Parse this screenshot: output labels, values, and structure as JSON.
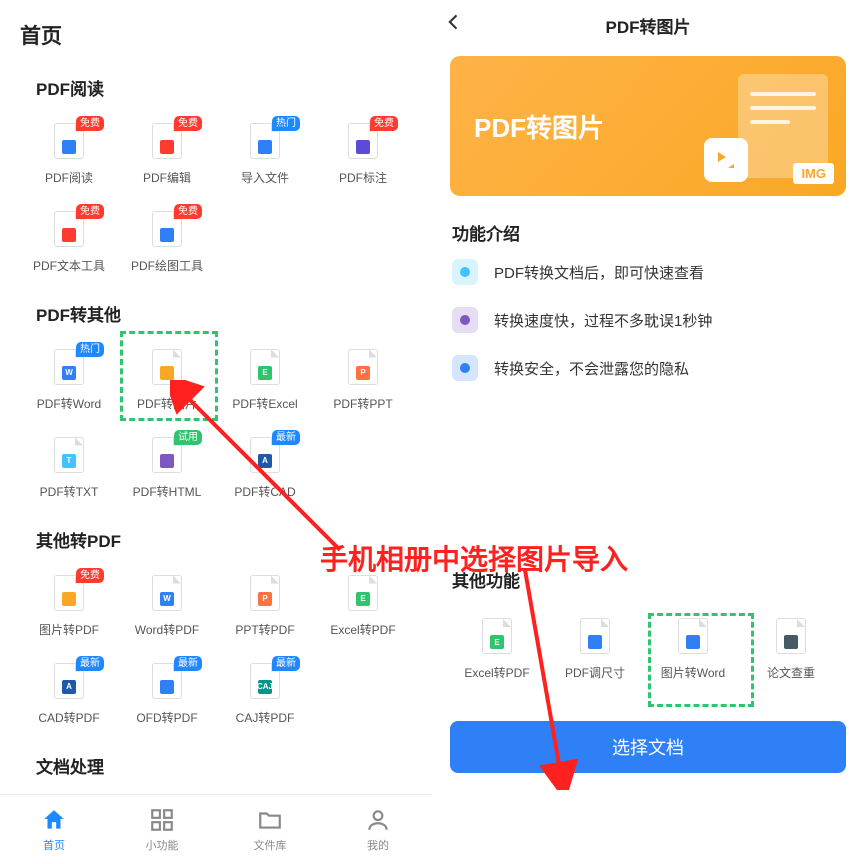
{
  "left": {
    "home_title": "首页",
    "sections": {
      "read": {
        "title": "PDF阅读",
        "items": [
          {
            "label": "PDF阅读",
            "badge": "免费",
            "badge_type": "free",
            "color": "#2f7ff6"
          },
          {
            "label": "PDF编辑",
            "badge": "免费",
            "badge_type": "free",
            "color": "#ff3b30"
          },
          {
            "label": "导入文件",
            "badge": "热门",
            "badge_type": "hot",
            "color": "#2f7ff6"
          },
          {
            "label": "PDF标注",
            "badge": "免费",
            "badge_type": "free",
            "color": "#5c4bd6"
          },
          {
            "label": "PDF文本工具",
            "badge": "免费",
            "badge_type": "free",
            "color": "#ff3b30"
          },
          {
            "label": "PDF绘图工具",
            "badge": "免费",
            "badge_type": "free",
            "color": "#2f7ff6"
          }
        ]
      },
      "convert": {
        "title": "PDF转其他",
        "items": [
          {
            "label": "PDF转Word",
            "badge": "热门",
            "badge_type": "hot",
            "color": "#2f7ff6",
            "letter": "W"
          },
          {
            "label": "PDF转图片",
            "badge": "",
            "badge_type": "",
            "color": "#f9a825",
            "letter": ""
          },
          {
            "label": "PDF转Excel",
            "badge": "",
            "badge_type": "",
            "color": "#2fc46e",
            "letter": "E"
          },
          {
            "label": "PDF转PPT",
            "badge": "",
            "badge_type": "",
            "color": "#ff7043",
            "letter": "P"
          },
          {
            "label": "PDF转TXT",
            "badge": "",
            "badge_type": "",
            "color": "#40c4ff",
            "letter": "T"
          },
          {
            "label": "PDF转HTML",
            "badge": "试用",
            "badge_type": "trial",
            "color": "#7e57c2",
            "letter": ""
          },
          {
            "label": "PDF转CAD",
            "badge": "最新",
            "badge_type": "new",
            "color": "#1e5aa8",
            "letter": "A"
          }
        ]
      },
      "topdf": {
        "title": "其他转PDF",
        "items": [
          {
            "label": "图片转PDF",
            "badge": "免费",
            "badge_type": "free",
            "color": "#f9a825"
          },
          {
            "label": "Word转PDF",
            "badge": "",
            "badge_type": "",
            "color": "#2f7ff6",
            "letter": "W"
          },
          {
            "label": "PPT转PDF",
            "badge": "",
            "badge_type": "",
            "color": "#ff7043",
            "letter": "P"
          },
          {
            "label": "Excel转PDF",
            "badge": "",
            "badge_type": "",
            "color": "#2fc46e",
            "letter": "E"
          },
          {
            "label": "CAD转PDF",
            "badge": "最新",
            "badge_type": "new",
            "color": "#1e5aa8",
            "letter": "A"
          },
          {
            "label": "OFD转PDF",
            "badge": "最新",
            "badge_type": "new",
            "color": "#2f7ff6"
          },
          {
            "label": "CAJ转PDF",
            "badge": "最新",
            "badge_type": "new",
            "color": "#009688",
            "letter": "CAJ"
          }
        ]
      },
      "doc": {
        "title": "文档处理"
      }
    },
    "nav": [
      {
        "label": "首页",
        "icon": "home"
      },
      {
        "label": "小功能",
        "icon": "grid"
      },
      {
        "label": "文件库",
        "icon": "folder"
      },
      {
        "label": "我的",
        "icon": "user"
      }
    ]
  },
  "right": {
    "title": "PDF转图片",
    "banner_text": "PDF转图片",
    "banner_tag": "IMG",
    "intro_title": "功能介绍",
    "features": [
      {
        "text": "PDF转换文档后，即可快速查看",
        "color": "#40c4ff"
      },
      {
        "text": "转换速度快，过程不多耽误1秒钟",
        "color": "#7e57c2"
      },
      {
        "text": "转换安全，不会泄露您的隐私",
        "color": "#2f7ff6"
      }
    ],
    "other_title": "其他功能",
    "other": [
      {
        "label": "Excel转PDF",
        "color": "#2fc46e",
        "letter": "E"
      },
      {
        "label": "PDF调尺寸",
        "color": "#2f7ff6"
      },
      {
        "label": "图片转Word",
        "color": "#2f7ff6"
      },
      {
        "label": "论文查重",
        "color": "#455a64"
      }
    ],
    "button": "选择文档"
  },
  "annotation": "手机相册中选择图片导入"
}
